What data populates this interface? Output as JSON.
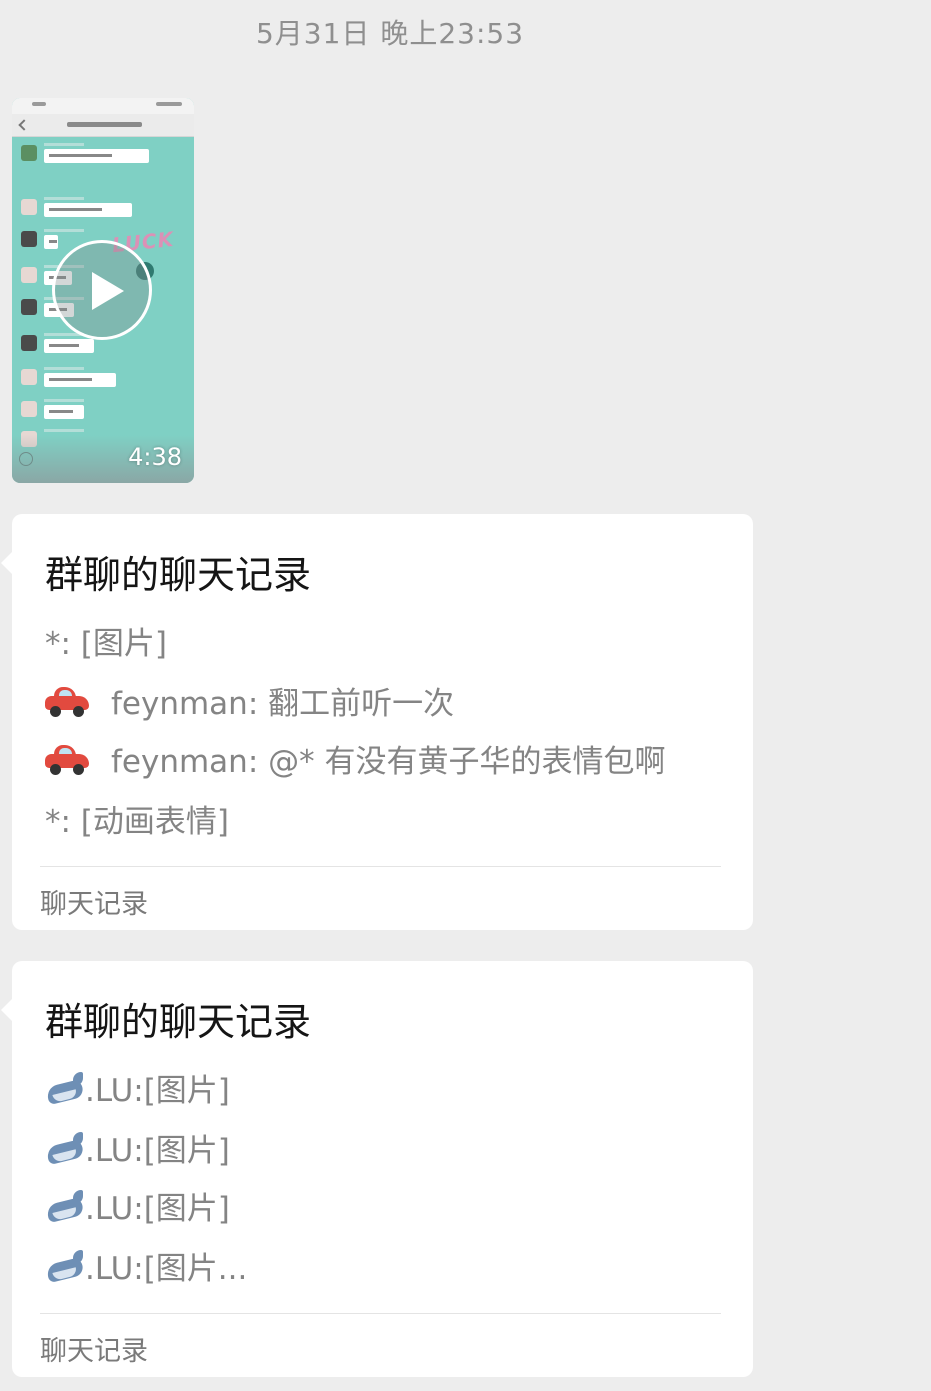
{
  "timestamp": "5月31日 晚上23:53",
  "video": {
    "duration": "4:38",
    "sticker_text": "LUCK"
  },
  "cards": [
    {
      "title": "群聊的聊天记录",
      "lines": [
        {
          "text": "*: [图片]"
        },
        {
          "emoji": "car-icon",
          "text": "feynman: 翻工前听一次"
        },
        {
          "emoji": "car-icon",
          "text": "feynman: @* 有没有黄子华的表情包啊"
        },
        {
          "text": "*: [动画表情]"
        }
      ],
      "footer": "聊天记录"
    },
    {
      "title": "群聊的聊天记录",
      "lines": [
        {
          "emoji": "whale-icon",
          "text": ".LU:[图片]"
        },
        {
          "emoji": "whale-icon",
          "text": ".LU:[图片]"
        },
        {
          "emoji": "whale-icon",
          "text": ".LU:[图片]"
        },
        {
          "emoji": "whale-icon",
          "text": ".LU:[图片..."
        }
      ],
      "footer": "聊天记录"
    }
  ],
  "colors": {
    "background": "#ededed",
    "card": "#ffffff",
    "title": "#151515",
    "preview_text": "#848484",
    "video_bg": "#7fd0c4"
  }
}
